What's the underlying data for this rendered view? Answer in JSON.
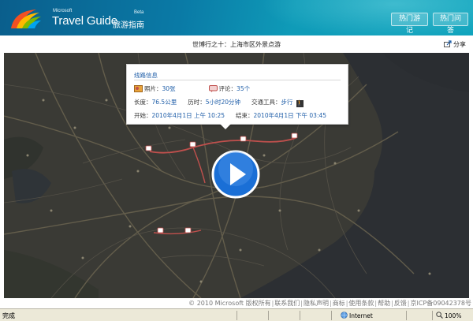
{
  "header": {
    "brand_small": "Microsoft",
    "brand_name": "Travel Guide",
    "brand_cn": "旅游指南",
    "beta": "Beta",
    "btn_travel": "热门游记",
    "btn_qa": "热门问答"
  },
  "titlebar": {
    "title": "世博行之十：上海市区外景点游",
    "share": "分享"
  },
  "panel": {
    "heading": "线路信息",
    "photos_label": "照片：",
    "photos_value": "30张",
    "comments_label": "评论：",
    "comments_value": "35个",
    "length_label": "长度：",
    "length_value": "76.5公里",
    "duration_label": "历时：",
    "duration_value": "5小时20分钟",
    "transport_label": "交通工具：",
    "transport_value": "步行",
    "start_label": "开始：",
    "start_value": "2010年4月1日 上午 10:25",
    "end_label": "结束：",
    "end_value": "2010年4月1日 下午 03:45"
  },
  "footer": {
    "copyright": "© 2010 Microsoft 版权所有",
    "links": [
      "联系我们",
      "隐私声明",
      "商标",
      "使用条款",
      "帮助",
      "反馈",
      "京ICP备09042378号"
    ]
  },
  "statusbar": {
    "status": "完成",
    "zone": "Internet",
    "zoom": "100%"
  },
  "colors": {
    "header_start": "#0a5e8c",
    "header_end": "#10a4bd",
    "link": "#1f5ea8",
    "play": "#1a6fd6",
    "map_bg": "#2b2b2b"
  },
  "icons": [
    "photo-icon",
    "comment-icon",
    "walk-icon",
    "share-icon",
    "play-icon",
    "globe-icon"
  ]
}
